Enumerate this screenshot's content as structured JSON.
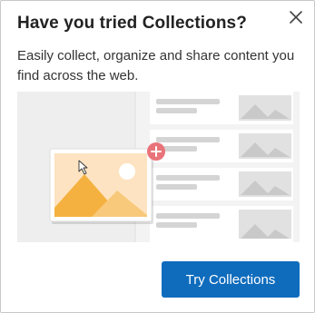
{
  "popup": {
    "title": "Have you tried Collections?",
    "description": "Easily collect, organize and share content you find across the web.",
    "cta_label": "Try Collections",
    "close_icon": "close-icon",
    "colors": {
      "cta_background": "#0f6cbd",
      "add_badge": "#e9737a",
      "card_background": "#fde3c1",
      "mountain_dark": "#f5b140",
      "mountain_light": "#f8c97a"
    }
  }
}
